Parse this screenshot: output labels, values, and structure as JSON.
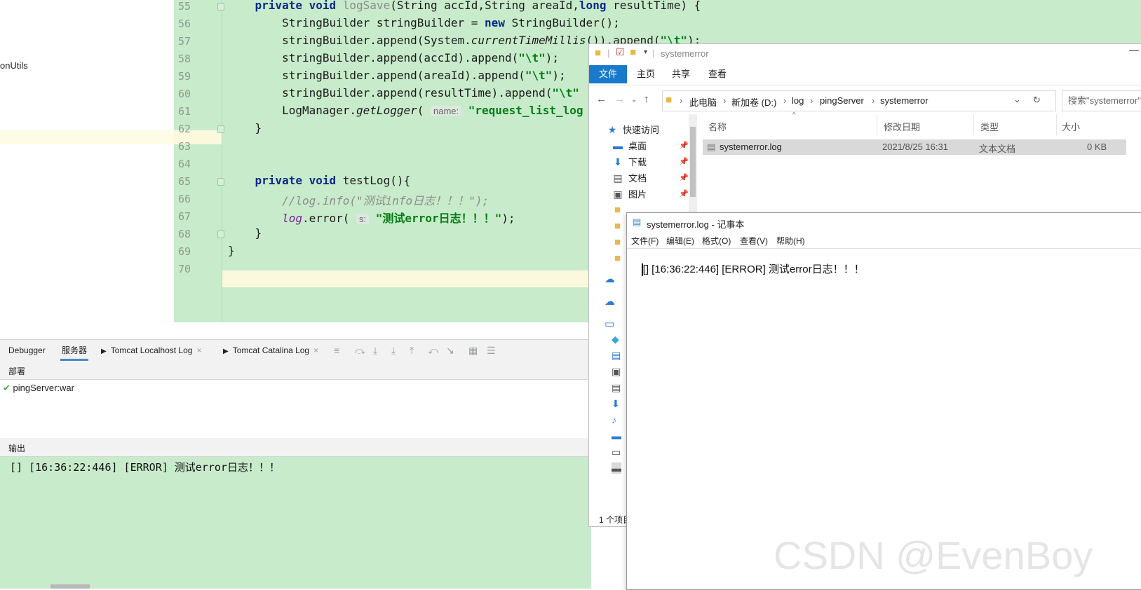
{
  "sidebar": {
    "item_label": "onUtils"
  },
  "editor": {
    "lines": [
      {
        "num": "55"
      },
      {
        "num": "56"
      },
      {
        "num": "57"
      },
      {
        "num": "58"
      },
      {
        "num": "59"
      },
      {
        "num": "60"
      },
      {
        "num": "61"
      },
      {
        "num": "62"
      },
      {
        "num": "63"
      },
      {
        "num": "64"
      },
      {
        "num": "65"
      },
      {
        "num": "66"
      },
      {
        "num": "67"
      },
      {
        "num": "68"
      },
      {
        "num": "69"
      },
      {
        "num": "70"
      }
    ],
    "code": {
      "l55_kw": "private void ",
      "l55_name": "logSave",
      "l55_rest": "(String accId,String areaId,",
      "l55_kw2": "long",
      "l55_end": " resultTime) {",
      "l56_a": "    StringBuilder stringBuilder = ",
      "l56_kw": "new",
      "l56_b": " StringBuilder();",
      "l57_a": "    stringBuilder.append(System.",
      "l57_it": "currentTimeMillis",
      "l57_b": "()).append(",
      "l57_s": "\"\\t\"",
      "l57_c": ");",
      "l58_a": "    stringBuilder.append(accId).append(",
      "l58_s": "\"\\t\"",
      "l58_b": ");",
      "l59_a": "    stringBuilder.append(areaId).append(",
      "l59_s": "\"\\t\"",
      "l59_b": ");",
      "l60_a": "    stringBuilder.append(resultTime).append(",
      "l60_s": "\"\\t\"",
      "l61_a": "    LogManager.",
      "l61_it": "getLogger",
      "l61_b": "( ",
      "l61_hint": "name:",
      "l61_s": " \"request_list_log",
      "l62": "}",
      "l65_kw": "private void ",
      "l65_rest": "testLog(){",
      "l66": "    //log.info(\"测试info日志！！！\");",
      "l67_a": "    ",
      "l67_fld": "log",
      "l67_b": ".error( ",
      "l67_hint": "s:",
      "l67_s": " \"测试error日志！！！\"",
      "l67_c": ");",
      "l68": "}",
      "l69": "}"
    }
  },
  "toolwindow": {
    "tabs": [
      "Debugger",
      "服务器",
      "Tomcat Localhost Log",
      "Tomcat Catalina Log"
    ],
    "close_glyph": "×",
    "deploy_header": "部署",
    "deploy_item": "pingServer:war",
    "output_header": "输出",
    "output_text": "[] [16:36:22:446] [ERROR] 测试error日志！！！"
  },
  "explorer": {
    "title": "systemerror",
    "ribbon_tabs": [
      "文件",
      "主页",
      "共享",
      "查看"
    ],
    "breadcrumb": [
      "此电脑",
      "新加卷 (D:)",
      "log",
      "pingServer",
      "systemerror"
    ],
    "search_placeholder": "搜索\"systemerror\"",
    "nav": {
      "quick_access": "快速访问",
      "items": [
        "桌面",
        "下载",
        "文档",
        "图片"
      ]
    },
    "columns": [
      "名称",
      "修改日期",
      "类型",
      "大小"
    ],
    "file": {
      "name": "systemerror.log",
      "modified": "2021/8/25 16:31",
      "type": "文本文档",
      "size": "0 KB"
    },
    "status": "1 个项目"
  },
  "notepad": {
    "title": "systemerror.log - 记事本",
    "menu": [
      "文件(F)",
      "编辑(E)",
      "格式(O)",
      "查看(V)",
      "帮助(H)"
    ],
    "content": "[] [16:36:22:446] [ERROR] 测试error日志！！！"
  },
  "watermark": "CSDN @EvenBoy",
  "colors": {
    "editor_bg": "#c8ebcb",
    "ribbon_file_bg": "#1979ca",
    "string_green": "#067d17",
    "keyword_blue": "#0b2a8a"
  }
}
